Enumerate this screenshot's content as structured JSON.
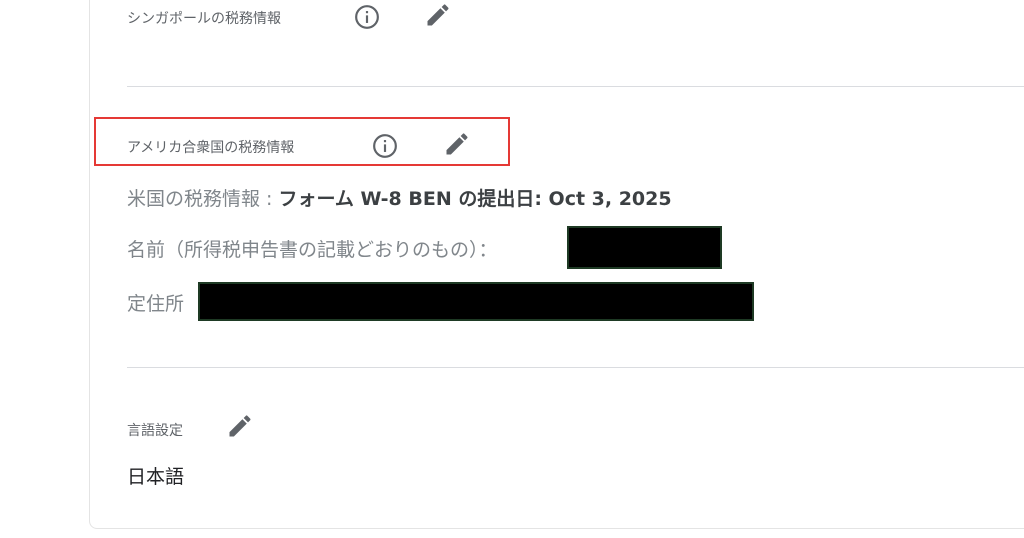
{
  "sections": {
    "singapore": {
      "title": "シンガポールの税務情報",
      "info_icon": "info-circle-icon",
      "edit_icon": "pencil-icon"
    },
    "usa": {
      "title": "アメリカ合衆国の税務情報",
      "info_icon": "info-circle-icon",
      "edit_icon": "pencil-icon",
      "rows": {
        "form_label": "米国の税務情報 : ",
        "form_value": "フォーム W-8 BEN の提出日: Oct 3, 2025",
        "name_label": "名前（所得税申告書の記載どおりのもの）：",
        "address_label": "定住所"
      }
    },
    "language": {
      "title": "言語設定",
      "edit_icon": "pencil-icon",
      "value": "日本語"
    }
  },
  "colors": {
    "highlight": "#e53935",
    "divider": "#dadce0",
    "icon": "#5f6368",
    "redaction": "#000000"
  }
}
